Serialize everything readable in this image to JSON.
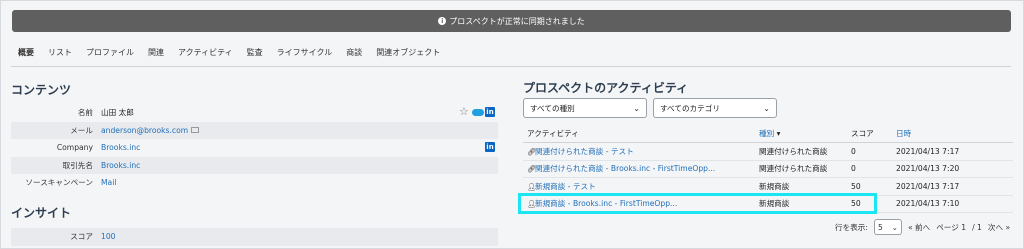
{
  "banner": {
    "message": "プロスペクトが正常に同期されました"
  },
  "tabs": [
    "概要",
    "リスト",
    "プロファイル",
    "関連",
    "アクティビティ",
    "監査",
    "ライフサイクル",
    "商談",
    "関連オブジェクト"
  ],
  "contents": {
    "title": "コンテンツ",
    "fields": [
      {
        "label": "名前",
        "value": "山田 太郎"
      },
      {
        "label": "メール",
        "value": "anderson@brooks.com"
      },
      {
        "label": "Company",
        "value": "Brooks.inc"
      },
      {
        "label": "取引先名",
        "value": "Brooks.inc"
      },
      {
        "label": "ソースキャンペーン",
        "value": "Mail"
      }
    ]
  },
  "insight": {
    "title": "インサイト",
    "fields": [
      {
        "label": "スコア",
        "value": "100"
      }
    ]
  },
  "activity": {
    "title": "プロスペクトのアクティビティ",
    "filter_type": "すべての種別",
    "filter_category": "すべてのカテゴリ",
    "headers": {
      "activity": "アクティビティ",
      "type": "種別",
      "type_sort": "▾",
      "score": "スコア",
      "date": "日時"
    },
    "rows": [
      {
        "icon": "link-icon",
        "activity": "関連付けられた商談 - テスト",
        "type": "関連付けられた商談",
        "score": "0",
        "date": "2021/04/13 7:17"
      },
      {
        "icon": "link-icon",
        "activity": "関連付けられた商談 - Brooks.inc - FirstTimeOpp...",
        "type": "関連付けられた商談",
        "score": "0",
        "date": "2021/04/13 7:20"
      },
      {
        "icon": "person-icon",
        "activity": "新規商談 - テスト",
        "type": "新規商談",
        "score": "50",
        "date": "2021/04/13 7:17"
      },
      {
        "icon": "person-icon",
        "activity": "新規商談 - Brooks.inc - FirstTimeOpp...",
        "type": "新規商談",
        "score": "50",
        "date": "2021/04/13 7:10"
      }
    ]
  },
  "pager": {
    "show_label": "行を表示:",
    "page_size": "5",
    "prev": "« 前へ",
    "page_label": "ページ 1",
    "of_label": "/ 1",
    "next": "次へ »"
  },
  "colors": {
    "highlight": "#19e6f2",
    "link": "#1f6fb8",
    "banner": "#5f5f5f"
  }
}
